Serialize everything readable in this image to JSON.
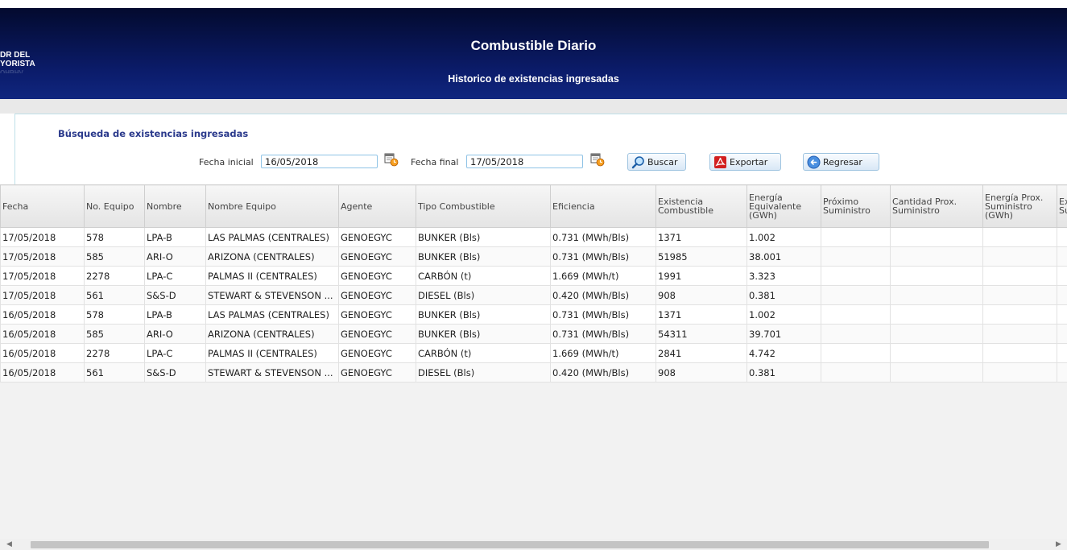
{
  "header": {
    "logo_lines": [
      "DR DEL",
      "YORISTA",
      "OHBHV"
    ],
    "title": "Combustible Diario",
    "subtitle": "Historico de existencias ingresadas"
  },
  "search": {
    "title": "Búsqueda de existencias ingresadas",
    "fecha_inicial_label": "Fecha inicial",
    "fecha_inicial_value": "16/05/2018",
    "fecha_final_label": "Fecha final",
    "fecha_final_value": "17/05/2018",
    "buttons": {
      "buscar": "Buscar",
      "exportar": "Exportar",
      "regresar": "Regresar"
    }
  },
  "table": {
    "columns": [
      "Fecha",
      "No. Equipo",
      "Nombre",
      "Nombre Equipo",
      "Agente",
      "Tipo Combustible",
      "Eficiencia",
      "Existencia Combustible",
      "Energía Equivalente (GWh)",
      "Próximo Suministro",
      "Cantidad Prox. Suministro",
      "Energía Prox. Suministro (GWh)",
      "Ex Su"
    ],
    "rows": [
      [
        "17/05/2018",
        "578",
        "LPA-B",
        "LAS PALMAS (CENTRALES)",
        "GENOEGYC",
        "BUNKER (Bls)",
        "0.731 (MWh/Bls)",
        "1371",
        "1.002",
        "",
        "",
        "",
        ""
      ],
      [
        "17/05/2018",
        "585",
        "ARI-O",
        "ARIZONA (CENTRALES)",
        "GENOEGYC",
        "BUNKER (Bls)",
        "0.731 (MWh/Bls)",
        "51985",
        "38.001",
        "",
        "",
        "",
        ""
      ],
      [
        "17/05/2018",
        "2278",
        "LPA-C",
        "PALMAS II (CENTRALES)",
        "GENOEGYC",
        "CARBÓN (t)",
        "1.669 (MWh/t)",
        "1991",
        "3.323",
        "",
        "",
        "",
        ""
      ],
      [
        "17/05/2018",
        "561",
        "S&S-D",
        "STEWART & STEVENSON ...",
        "GENOEGYC",
        "DIESEL (Bls)",
        "0.420 (MWh/Bls)",
        "908",
        "0.381",
        "",
        "",
        "",
        ""
      ],
      [
        "16/05/2018",
        "578",
        "LPA-B",
        "LAS PALMAS (CENTRALES)",
        "GENOEGYC",
        "BUNKER (Bls)",
        "0.731 (MWh/Bls)",
        "1371",
        "1.002",
        "",
        "",
        "",
        ""
      ],
      [
        "16/05/2018",
        "585",
        "ARI-O",
        "ARIZONA (CENTRALES)",
        "GENOEGYC",
        "BUNKER (Bls)",
        "0.731 (MWh/Bls)",
        "54311",
        "39.701",
        "",
        "",
        "",
        ""
      ],
      [
        "16/05/2018",
        "2278",
        "LPA-C",
        "PALMAS II (CENTRALES)",
        "GENOEGYC",
        "CARBÓN (t)",
        "1.669 (MWh/t)",
        "2841",
        "4.742",
        "",
        "",
        "",
        ""
      ],
      [
        "16/05/2018",
        "561",
        "S&S-D",
        "STEWART & STEVENSON ...",
        "GENOEGYC",
        "DIESEL (Bls)",
        "0.420 (MWh/Bls)",
        "908",
        "0.381",
        "",
        "",
        "",
        ""
      ]
    ]
  },
  "icons": {
    "calendar": "calendar-clock-icon",
    "buscar": "magnifier-icon",
    "exportar": "pdf-icon",
    "regresar": "back-arrow-icon"
  },
  "colors": {
    "header_dark": "#030a2e",
    "header_light": "#10267f",
    "search_title": "#2b3a8c",
    "input_border": "#8fc3e6"
  }
}
